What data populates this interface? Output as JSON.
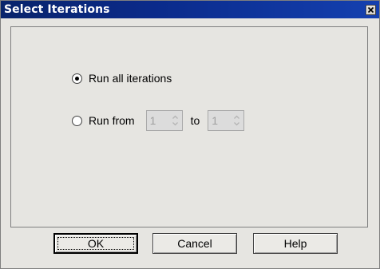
{
  "window": {
    "title": "Select Iterations",
    "close_icon": "close-icon"
  },
  "options": {
    "run_all": {
      "label": "Run all iterations",
      "selected": true
    },
    "run_from": {
      "label": "Run from",
      "selected": false,
      "from_value": "1",
      "to_label": "to",
      "to_value": "1",
      "enabled": false
    }
  },
  "buttons": {
    "ok": "OK",
    "cancel": "Cancel",
    "help": "Help"
  },
  "colors": {
    "titlebar": "#0a2a8a",
    "dialog_bg": "#e6e5e1"
  }
}
